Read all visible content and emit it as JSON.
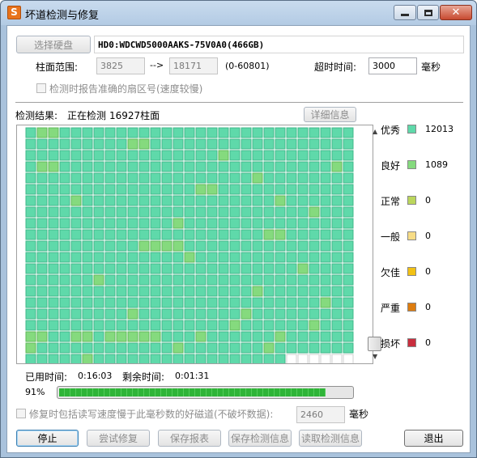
{
  "window": {
    "title": "坏道检测与修复",
    "app_icon_glyph": "S",
    "close_glyph": "✕"
  },
  "disk": {
    "select_button": "选择硬盘",
    "name": "HD0:WDCWD5000AAKS-75V0A0(466GB)"
  },
  "range": {
    "label": "柱面范围:",
    "start": "3825",
    "arrow": "-->",
    "end": "18171",
    "total": "(0-60801)"
  },
  "timeout": {
    "label": "超时时间:",
    "value": "3000",
    "unit": "毫秒"
  },
  "report_sector": {
    "label": "检测时报告准确的扇区号(速度较慢)"
  },
  "result": {
    "label": "检测结果:",
    "status": "正在检测",
    "cylinder": "16927柱面",
    "detail_button": "详细信息"
  },
  "legend": [
    {
      "label": "优秀",
      "count": "12013",
      "color": "#5fd9aa"
    },
    {
      "label": "良好",
      "count": "1089",
      "color": "#85da7e"
    },
    {
      "label": "正常",
      "count": "0",
      "color": "#bbd65c"
    },
    {
      "label": "一般",
      "count": "0",
      "color": "#f7dc86"
    },
    {
      "label": "欠佳",
      "count": "0",
      "color": "#f2c114"
    },
    {
      "label": "严重",
      "count": "0",
      "color": "#dd7c0e"
    },
    {
      "label": "损坏",
      "count": "0",
      "color": "#c92e3e"
    }
  ],
  "timing": {
    "used_label": "已用时间:",
    "used_value": "0:16:03",
    "remaining_label": "剩余时间:",
    "remaining_value": "0:01:31"
  },
  "progress": {
    "percent_text": "91%",
    "fraction": 0.91
  },
  "repair_option": {
    "label": "修复时包括读写速度慢于此毫秒数的好磁道(不破坏数据):",
    "value": "2460",
    "unit": "毫秒"
  },
  "buttons": {
    "stop": "停止",
    "try_repair": "尝试修复",
    "save_report": "保存报表",
    "save_info": "保存检测信息",
    "load_info": "读取检测信息",
    "exit": "退出"
  },
  "grid": {
    "columns": 29,
    "rows": 21,
    "excellent_color": "#5fd9aa",
    "good_color": "#85da7e",
    "pending_color": "#ffffff",
    "good_cells": [
      [
        0,
        1
      ],
      [
        0,
        2
      ],
      [
        1,
        9
      ],
      [
        1,
        10
      ],
      [
        2,
        17
      ],
      [
        3,
        1
      ],
      [
        3,
        2
      ],
      [
        3,
        27
      ],
      [
        4,
        20
      ],
      [
        5,
        15
      ],
      [
        5,
        16
      ],
      [
        6,
        4
      ],
      [
        6,
        22
      ],
      [
        7,
        25
      ],
      [
        8,
        13
      ],
      [
        9,
        21
      ],
      [
        9,
        22
      ],
      [
        10,
        10
      ],
      [
        10,
        11
      ],
      [
        10,
        12
      ],
      [
        10,
        13
      ],
      [
        11,
        14
      ],
      [
        12,
        24
      ],
      [
        13,
        6
      ],
      [
        14,
        20
      ],
      [
        15,
        26
      ],
      [
        16,
        9
      ],
      [
        16,
        19
      ],
      [
        17,
        18
      ],
      [
        17,
        25
      ],
      [
        18,
        0
      ],
      [
        18,
        1
      ],
      [
        18,
        4
      ],
      [
        18,
        5
      ],
      [
        18,
        7
      ],
      [
        18,
        8
      ],
      [
        18,
        9
      ],
      [
        18,
        10
      ],
      [
        18,
        11
      ],
      [
        18,
        15
      ],
      [
        18,
        22
      ],
      [
        19,
        0
      ],
      [
        19,
        13
      ],
      [
        19,
        21
      ],
      [
        20,
        5
      ]
    ],
    "pending_from_col_last_row": 23
  }
}
